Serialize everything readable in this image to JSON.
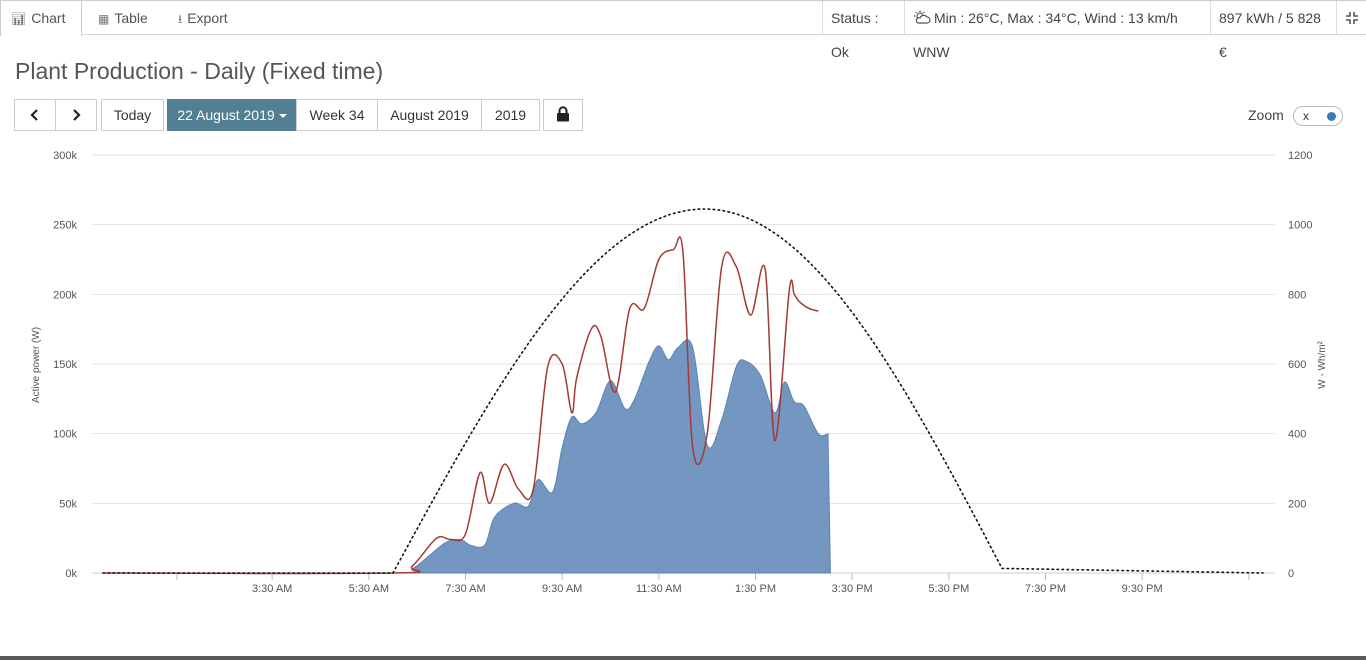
{
  "tabs": [
    {
      "label": "Chart",
      "icon": "bar-chart-icon"
    },
    {
      "label": "Table",
      "icon": "table-icon"
    },
    {
      "label": "Export",
      "icon": "download-icon"
    }
  ],
  "status": {
    "state": "Status : Ok",
    "weather": "Min : 26°C, Max : 34°C, Wind : 13 km/h WNW",
    "energy": "897 kWh / 5 828 €"
  },
  "page_title": "Plant Production - Daily (Fixed time)",
  "nav": {
    "today": "Today",
    "date": "22 August 2019",
    "week": "Week 34",
    "month": "August 2019",
    "year": "2019"
  },
  "zoom": {
    "label": "Zoom",
    "value": "x"
  },
  "colors": {
    "accent": "#527f93",
    "area": "#5b85b5",
    "line": "#a33b34",
    "dotted": "#111111"
  },
  "chart_data": {
    "type": "area",
    "title": "",
    "ylabel": "Active power (W)",
    "y2label": "W - Wh/m²",
    "ylim": [
      0,
      300000
    ],
    "y2lim": [
      0,
      1200
    ],
    "yticks": [
      "300k",
      "250k",
      "200k",
      "150k",
      "100k",
      "50k",
      "0k"
    ],
    "y2ticks": [
      "1200",
      "1000",
      "800",
      "600",
      "400",
      "200",
      "0"
    ],
    "xticks": [
      "3:30 AM",
      "5:30 AM",
      "7:30 AM",
      "9:30 AM",
      "11:30 AM",
      "1:30 PM",
      "3:30 PM",
      "5:30 PM",
      "7:30 PM",
      "9:30 PM"
    ],
    "x_tick_hours": [
      3.5,
      5.5,
      7.5,
      9.5,
      11.5,
      13.5,
      15.5,
      17.5,
      19.5,
      21.5
    ],
    "xlim_hours": [
      0,
      24
    ],
    "grid": true,
    "series": [
      {
        "type": "area",
        "axis": "left",
        "x": [
          0,
          6.0,
          6.4,
          6.8,
          7.1,
          7.4,
          7.6,
          7.9,
          8.1,
          8.5,
          8.8,
          9.0,
          9.3,
          9.5,
          9.7,
          9.9,
          10.2,
          10.5,
          10.8,
          11.0,
          11.3,
          11.5,
          11.7,
          11.9,
          12.2,
          12.5,
          12.8,
          13.1,
          13.3,
          13.6,
          13.9,
          14.1,
          14.3,
          14.5,
          14.8,
          15.0,
          15.05
        ],
        "y": [
          0,
          0,
          3000,
          14000,
          22000,
          24000,
          20000,
          20000,
          40000,
          50000,
          48000,
          67000,
          58000,
          90000,
          112000,
          107000,
          115000,
          138000,
          118000,
          125000,
          152000,
          163000,
          153000,
          162000,
          162000,
          92000,
          110000,
          148000,
          152000,
          142000,
          115000,
          137000,
          123000,
          120000,
          100000,
          100000,
          0
        ]
      },
      {
        "type": "line",
        "axis": "left",
        "x": [
          0,
          6.0,
          6.4,
          6.9,
          7.2,
          7.5,
          7.8,
          8.0,
          8.3,
          8.6,
          8.9,
          9.2,
          9.5,
          9.7,
          9.8,
          10.1,
          10.3,
          10.6,
          10.9,
          11.2,
          11.5,
          11.8,
          12.0,
          12.2,
          12.5,
          12.8,
          13.1,
          13.4,
          13.7,
          13.9,
          14.2,
          14.3,
          14.4,
          14.6,
          14.8,
          15.0,
          15.2
        ],
        "y": [
          0,
          0,
          5000,
          25000,
          24000,
          28000,
          72000,
          50000,
          78000,
          60000,
          60000,
          148000,
          150000,
          115000,
          140000,
          175000,
          170000,
          130000,
          190000,
          190000,
          225000,
          232000,
          230000,
          90000,
          100000,
          220000,
          220000,
          185000,
          218000,
          95000,
          203000,
          200000,
          195000,
          190000,
          188000,
          0,
          0
        ],
        "end_hour": 14.9
      },
      {
        "type": "line",
        "style": "dotted",
        "axis": "right",
        "name": "",
        "shape": "bell",
        "start_hour": 6.0,
        "peak_hour": 12.45,
        "end_hour": 18.65,
        "peak_value": 1045
      }
    ]
  }
}
